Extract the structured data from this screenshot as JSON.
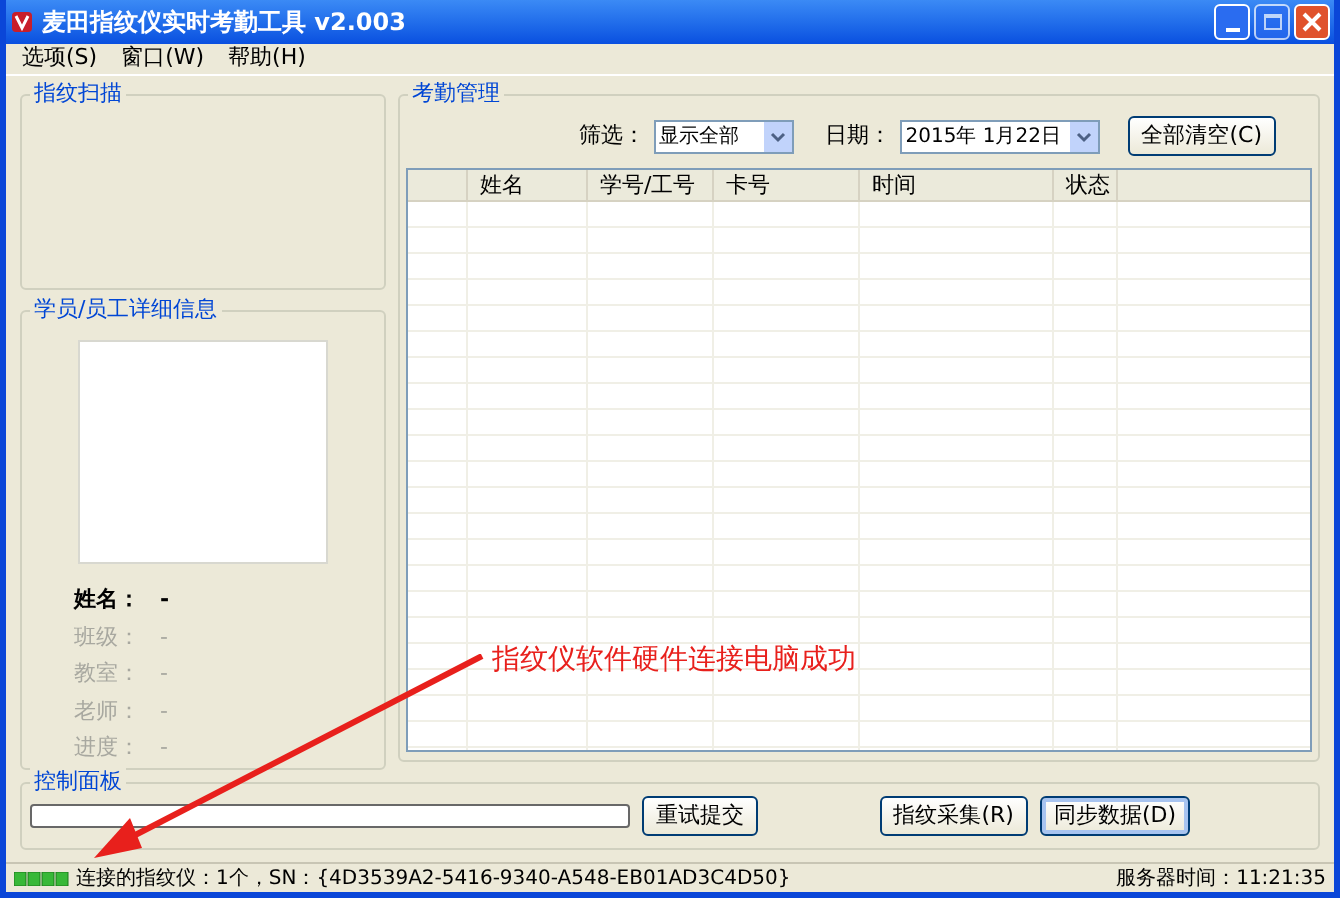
{
  "window": {
    "title": "麦田指纹仪实时考勤工具 v2.003"
  },
  "menu": [
    "选项(S)",
    "窗口(W)",
    "帮助(H)"
  ],
  "scan_group": {
    "title": "指纹扫描"
  },
  "detail_group": {
    "title": "学员/员工详细信息",
    "fields": [
      {
        "label": "姓名：",
        "value": "-",
        "disabled": false
      },
      {
        "label": "班级：",
        "value": "-",
        "disabled": true
      },
      {
        "label": "教室：",
        "value": "-",
        "disabled": true
      },
      {
        "label": "老师：",
        "value": "-",
        "disabled": true
      },
      {
        "label": "进度：",
        "value": "-",
        "disabled": true
      }
    ]
  },
  "attendance_group": {
    "title": "考勤管理",
    "filter_label": "筛选：",
    "filter_value": "显示全部",
    "date_label": "日期：",
    "date_value": "2015年 1月22日",
    "clear_button": "全部清空(C)",
    "table": {
      "columns": [
        "姓名",
        "学号/工号",
        "卡号",
        "时间",
        "状态"
      ]
    }
  },
  "annotation": {
    "text": "指纹仪软件硬件连接电脑成功"
  },
  "control_group": {
    "title": "控制面板",
    "progress": {
      "level": 0
    },
    "buttons": [
      {
        "label": "重试提交",
        "selected": false
      },
      {
        "label": "指纹采集(R)",
        "selected": false
      },
      {
        "label": "同步数据(D)",
        "selected": true
      }
    ]
  },
  "status_bar": {
    "connection": "连接的指纹仪：1个，SN：{4D3539A2-5416-9340-A548-EB01AD3C4D50}",
    "server_time": "服务器时间：11:21:35"
  }
}
